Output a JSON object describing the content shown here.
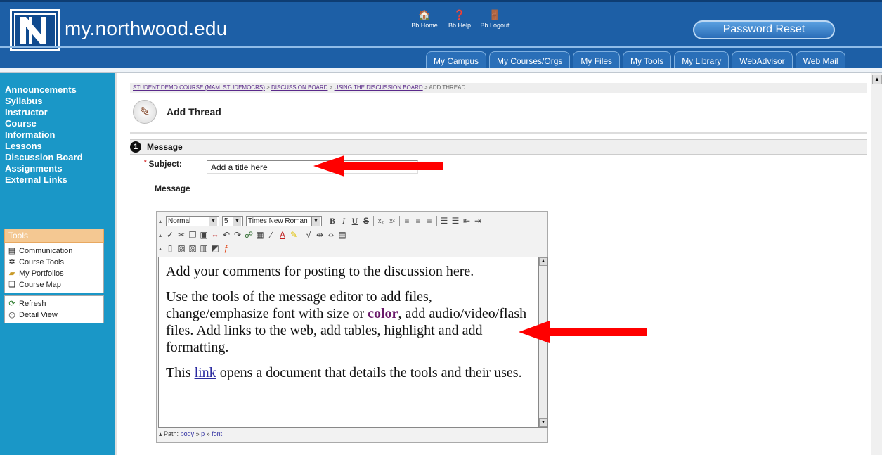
{
  "header": {
    "site_name": "my.northwood.edu",
    "top_links": [
      {
        "label": "Bb Home",
        "icon": "home-icon",
        "glyph": "🏠"
      },
      {
        "label": "Bb Help",
        "icon": "help-icon",
        "glyph": "❓"
      },
      {
        "label": "Bb Logout",
        "icon": "logout-icon",
        "glyph": "🚪"
      }
    ],
    "password_button": "Password Reset",
    "tabs": [
      "My Campus",
      "My Courses/Orgs",
      "My Files",
      "My Tools",
      "My Library",
      "WebAdvisor",
      "Web Mail"
    ]
  },
  "sidebar": {
    "course_menu": [
      "Announcements",
      "Syllabus",
      "Instructor",
      "Course Information",
      "Lessons",
      "Discussion Board",
      "Assignments",
      "External Links"
    ],
    "tools_title": "Tools",
    "tools": [
      {
        "label": "Communication",
        "icon": "communication-icon",
        "glyph": "▤"
      },
      {
        "label": "Course Tools",
        "icon": "course-tools-icon",
        "glyph": "✲"
      },
      {
        "label": "My Portfolios",
        "icon": "portfolio-icon",
        "glyph": "▰"
      },
      {
        "label": "Course Map",
        "icon": "course-map-icon",
        "glyph": "❑"
      }
    ],
    "tools2": [
      {
        "label": "Refresh",
        "icon": "refresh-icon",
        "glyph": "⟳"
      },
      {
        "label": "Detail View",
        "icon": "detail-view-icon",
        "glyph": "◎"
      }
    ]
  },
  "main": {
    "breadcrumb": {
      "items": [
        "STUDENT DEMO COURSE (MAM_STUDEMOCRS)",
        "DISCUSSION BOARD",
        "USING THE DISCUSSION BOARD"
      ],
      "separator": " > ",
      "current": "ADD THREAD"
    },
    "page_title": "Add Thread",
    "section": {
      "number": "1",
      "title": "Message"
    },
    "subject_label": "Subject:",
    "subject_value": "Add a title here",
    "message_label": "Message",
    "editor": {
      "format_select": "Normal",
      "size_select": "5",
      "font_select": "Times New Roman",
      "paragraph1": "Add your comments for posting to the discussion here.",
      "paragraph2_a": "Use the tools of the message editor to add files, change/emphasize font with size or ",
      "paragraph2_color": "color",
      "paragraph2_b": ", add audio/video/flash files.  Add links to the web, add tables, highlight and add formatting.",
      "paragraph3_a": "This ",
      "paragraph3_link": "link",
      "paragraph3_b": "  opens a document that details the tools and their uses.",
      "path_label": "Path:",
      "path_items": [
        "body",
        "p",
        "font"
      ]
    }
  },
  "colors": {
    "header_blue": "#1d5fa6",
    "sidebar_blue": "#1a97c7",
    "arrow_red": "#ff0000"
  }
}
